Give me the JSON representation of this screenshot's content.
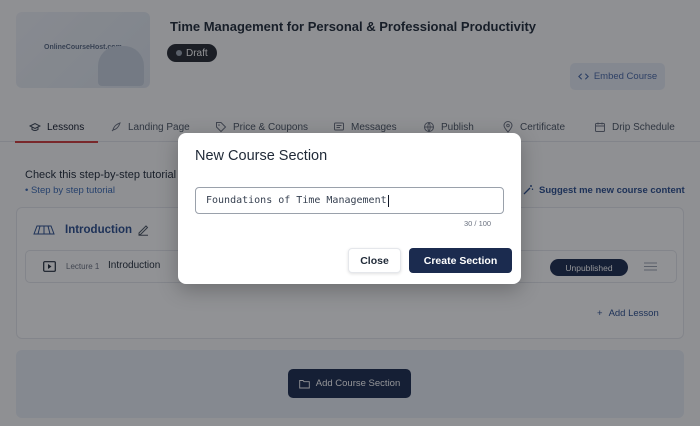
{
  "course": {
    "title": "Time Management for Personal & Professional Productivity",
    "status": "Draft",
    "thumbnail_brand": "OnlineCourseHost.com",
    "embed_label": "Embed Course"
  },
  "tabs": [
    {
      "label": "Lessons",
      "icon": "graduation-cap-icon",
      "active": true
    },
    {
      "label": "Landing Page",
      "icon": "rocket-icon",
      "active": false
    },
    {
      "label": "Price & Coupons",
      "icon": "tag-icon",
      "active": false
    },
    {
      "label": "Messages",
      "icon": "message-icon",
      "active": false
    },
    {
      "label": "Publish",
      "icon": "globe-icon",
      "active": false
    },
    {
      "label": "Certificate",
      "icon": "location-pin-icon",
      "active": false
    },
    {
      "label": "Drip Schedule",
      "icon": "calendar-icon",
      "active": false
    }
  ],
  "tutorial": {
    "text": "Check this step-by-step tutorial",
    "link": "Step by step tutorial"
  },
  "suggest_label": "Suggest me new course content",
  "section": {
    "title": "Introduction",
    "lecture": {
      "number": "Lecture 1",
      "name": "Introduction",
      "status": "Unpublished"
    },
    "add_lesson_label": "Add Lesson"
  },
  "add_section_label": "Add Course Section",
  "modal": {
    "title": "New Course Section",
    "input_value": "Foundations of Time Management",
    "counter": "30 / 100",
    "close_label": "Close",
    "create_label": "Create Section"
  },
  "colors": {
    "accent_navy": "#1b2b4f",
    "link_blue": "#2b4f8f",
    "active_tab_underline": "#d23b3b"
  }
}
